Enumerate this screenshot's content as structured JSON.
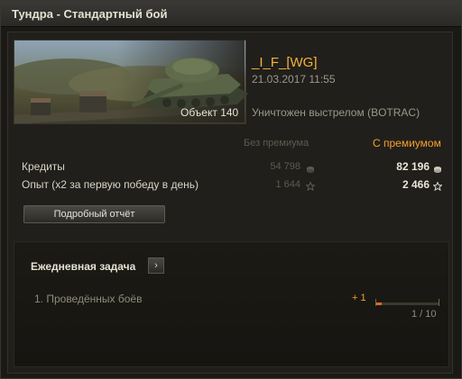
{
  "window": {
    "title": "Тундра - Стандартный бой"
  },
  "battle": {
    "player_name": "_I_F_[WG]",
    "date": "21.03.2017 11:55",
    "vehicle": "Объект 140",
    "death_reason": "Уничтожен выстрелом (BOTRAC)"
  },
  "earnings": {
    "col_base": "Без премиума",
    "col_premium": "С премиумом",
    "rows": [
      {
        "label": "Кредиты",
        "base": "54 798",
        "premium": "82 196",
        "icon": "credits-icon"
      },
      {
        "label": "Опыт  (x2 за первую победу в день)",
        "base": "1 644",
        "premium": "2 466",
        "icon": "star-icon"
      }
    ]
  },
  "details_button": {
    "label": "Подробный отчёт"
  },
  "daily_task": {
    "title": "Ежедневная задача",
    "arrow": "›",
    "item": "1. Проведённых боёв",
    "gain": "+ 1",
    "progress": {
      "current": 1,
      "total": 10
    },
    "count_text": "1 / 10"
  },
  "colors": {
    "accent": "#f7a02e",
    "name": "#f7b23a",
    "progress_fill": "#e06a1e"
  }
}
